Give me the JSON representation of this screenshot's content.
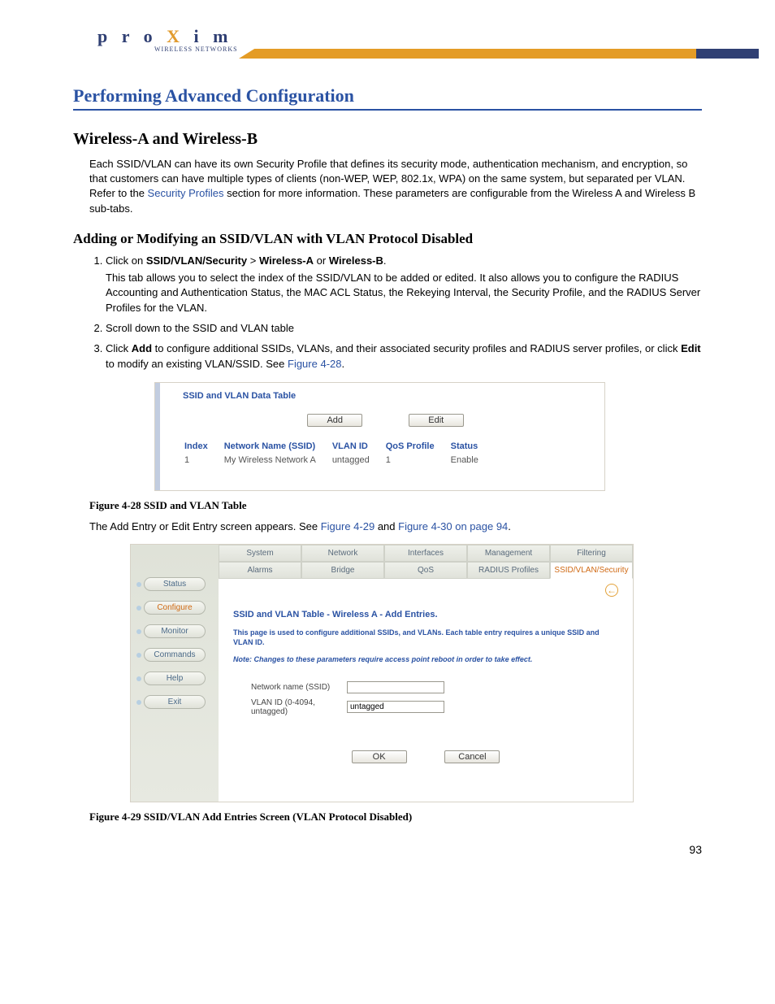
{
  "logo": {
    "brand": "proXim",
    "sub": "WIRELESS NETWORKS"
  },
  "page_title": "Performing Advanced Configuration",
  "section_title": "Wireless-A and Wireless-B",
  "intro_pre": "Each SSID/VLAN can have its own Security Profile that defines its security mode, authentication mechanism, and encryption, so that customers can have multiple types of clients (non-WEP, WEP, 802.1x, WPA) on the same system, but separated per VLAN. Refer to the ",
  "intro_link": "Security Profiles",
  "intro_post": " section for more information. These parameters are configurable from the Wireless A and Wireless B sub-tabs.",
  "subsection_title": "Adding or Modifying an SSID/VLAN with VLAN Protocol Disabled",
  "steps": {
    "s1_pre": "Click on ",
    "s1_b1": "SSID/VLAN/Security",
    "s1_gt": " > ",
    "s1_b2": "Wireless-A",
    "s1_or": " or ",
    "s1_b3": "Wireless-B",
    "s1_end": ".",
    "s1_detail": "This tab allows you to select the index of the SSID/VLAN to be added or edited. It also allows you to configure the RADIUS Accounting and Authentication Status, the MAC ACL Status, the Rekeying Interval, the Security Profile, and the RADIUS Server Profiles for the VLAN.",
    "s2": "Scroll down to the SSID and VLAN table",
    "s3_pre": "Click ",
    "s3_b1": "Add",
    "s3_mid": " to configure additional SSIDs, VLANs, and their associated security profiles and RADIUS server profiles, or click ",
    "s3_b2": "Edit",
    "s3_post": " to modify an existing VLAN/SSID. See ",
    "s3_link": "Figure 4-28",
    "s3_end": "."
  },
  "fig28": {
    "title": "SSID and VLAN Data Table",
    "btn_add": "Add",
    "btn_edit": "Edit",
    "headers": {
      "index": "Index",
      "ssid": "Network Name (SSID)",
      "vlan": "VLAN ID",
      "qos": "QoS Profile",
      "status": "Status"
    },
    "row": {
      "index": "1",
      "ssid": "My Wireless Network A",
      "vlan": "untagged",
      "qos": "1",
      "status": "Enable"
    },
    "caption": "Figure 4-28    SSID and VLAN Table"
  },
  "post_fig28_pre": "The Add Entry or Edit Entry screen appears. See ",
  "post_fig28_link1": "Figure 4-29",
  "post_fig28_and": " and ",
  "post_fig28_link2": "Figure 4-30 on page 94",
  "post_fig28_end": ".",
  "fig29": {
    "side": {
      "status": "Status",
      "configure": "Configure",
      "monitor": "Monitor",
      "commands": "Commands",
      "help": "Help",
      "exit": "Exit"
    },
    "tabs_row1": {
      "system": "System",
      "network": "Network",
      "interfaces": "Interfaces",
      "management": "Management",
      "filtering": "Filtering"
    },
    "tabs_row2": {
      "alarms": "Alarms",
      "bridge": "Bridge",
      "qos": "QoS",
      "radius": "RADIUS Profiles",
      "ssid": "SSID/VLAN/Security"
    },
    "heading": "SSID and VLAN Table - Wireless A - Add Entries.",
    "desc": "This page is used to configure additional SSIDs, and VLANs. Each table entry requires a unique SSID and VLAN ID.",
    "note": "Note: Changes to these parameters require access point reboot in order to take effect.",
    "lbl_ssid": "Network name (SSID)",
    "lbl_vlan": "VLAN ID (0-4094, untagged)",
    "val_ssid": "",
    "val_vlan": "untagged",
    "btn_ok": "OK",
    "btn_cancel": "Cancel",
    "caption": "Figure 4-29    SSID/VLAN Add Entries Screen (VLAN Protocol Disabled)"
  },
  "page_number": "93"
}
